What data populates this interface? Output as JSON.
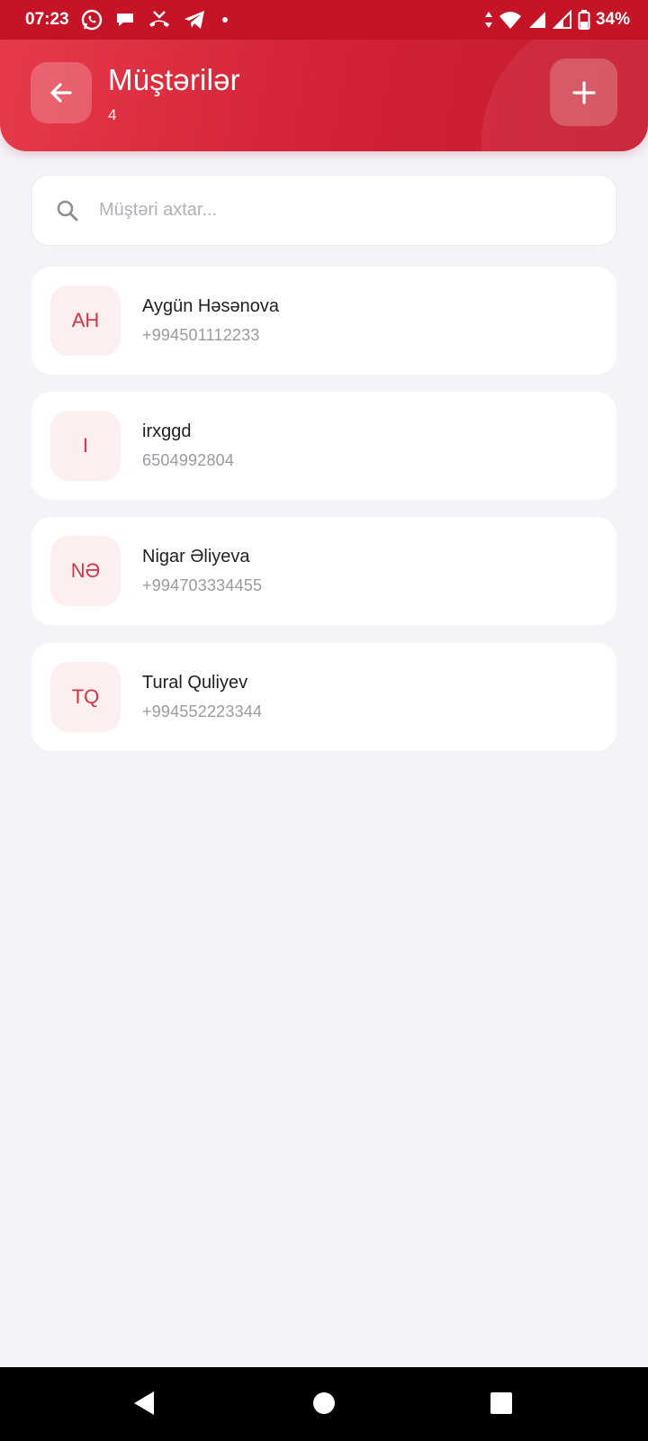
{
  "status_bar": {
    "time": "07:23",
    "battery": "34%",
    "left_icons": [
      "whatsapp-icon",
      "chat-bubble-icon",
      "missed-call-icon",
      "telegram-icon"
    ],
    "right_icons": [
      "data-arrows-icon",
      "wifi-icon",
      "signal-icon",
      "signal-icon",
      "battery-icon"
    ]
  },
  "header": {
    "title": "Müştərilər",
    "count": "4",
    "back_icon": "arrow-left-icon",
    "add_icon": "plus-icon",
    "colors": {
      "start": "#e63a4a",
      "end": "#c51a2d"
    }
  },
  "search": {
    "placeholder": "Müştəri axtar...",
    "value": ""
  },
  "customers": [
    {
      "initials": "AH",
      "name": "Aygün Həsənova",
      "phone": "+994501112233"
    },
    {
      "initials": "I",
      "name": "irxggd",
      "phone": "6504992804"
    },
    {
      "initials": "NƏ",
      "name": "Nigar Əliyeva",
      "phone": "+994703334455"
    },
    {
      "initials": "TQ",
      "name": "Tural Quliyev",
      "phone": "+994552223344"
    }
  ],
  "nav_bar": {
    "icons": [
      "back-triangle-icon",
      "home-circle-icon",
      "recents-square-icon"
    ]
  }
}
